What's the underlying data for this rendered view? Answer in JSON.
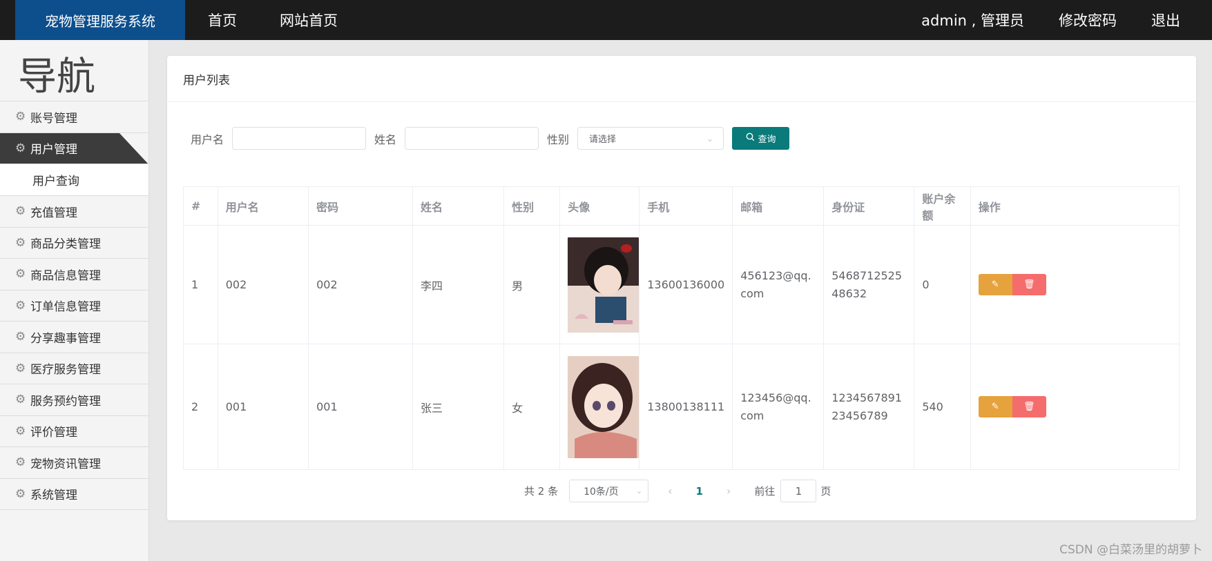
{
  "header": {
    "brand": "宠物管理服务系统",
    "nav": [
      "首页",
      "网站首页"
    ],
    "user": "admin , 管理员",
    "change_password": "修改密码",
    "logout": "退出"
  },
  "sidebar": {
    "title": "导航",
    "items": [
      {
        "label": "账号管理"
      },
      {
        "label": "用户管理"
      },
      {
        "label": "充值管理"
      },
      {
        "label": "商品分类管理"
      },
      {
        "label": "商品信息管理"
      },
      {
        "label": "订单信息管理"
      },
      {
        "label": "分享趣事管理"
      },
      {
        "label": "医疗服务管理"
      },
      {
        "label": "服务预约管理"
      },
      {
        "label": "评价管理"
      },
      {
        "label": "宠物资讯管理"
      },
      {
        "label": "系统管理"
      }
    ],
    "sub_item": "用户查询"
  },
  "card": {
    "title": "用户列表"
  },
  "filters": {
    "username_label": "用户名",
    "name_label": "姓名",
    "gender_label": "性别",
    "gender_placeholder": "请选择",
    "search_label": "查询"
  },
  "table": {
    "columns": [
      "#",
      "用户名",
      "密码",
      "姓名",
      "性别",
      "头像",
      "手机",
      "邮箱",
      "身份证",
      "账户余额",
      "操作"
    ],
    "rows": [
      {
        "idx": "1",
        "username": "002",
        "password": "002",
        "name": "李四",
        "gender": "男",
        "phone": "13600136000",
        "email": "456123@qq.com",
        "id_card": "546871252548632",
        "balance": "0"
      },
      {
        "idx": "2",
        "username": "001",
        "password": "001",
        "name": "张三",
        "gender": "女",
        "phone": "13800138111",
        "email": "123456@qq.com",
        "id_card": "123456789123456789",
        "balance": "540"
      }
    ]
  },
  "pagination": {
    "total": "共 2 条",
    "page_size": "10条/页",
    "current_page": "1",
    "goto_label": "前往",
    "goto_value": "1",
    "page_unit": "页"
  },
  "watermark": "CSDN @白菜汤里的胡萝卜",
  "colors": {
    "accent": "#0a7a7a",
    "edit": "#e6a23c",
    "delete": "#f56c6c",
    "brand_bg": "#0d4f8c"
  }
}
